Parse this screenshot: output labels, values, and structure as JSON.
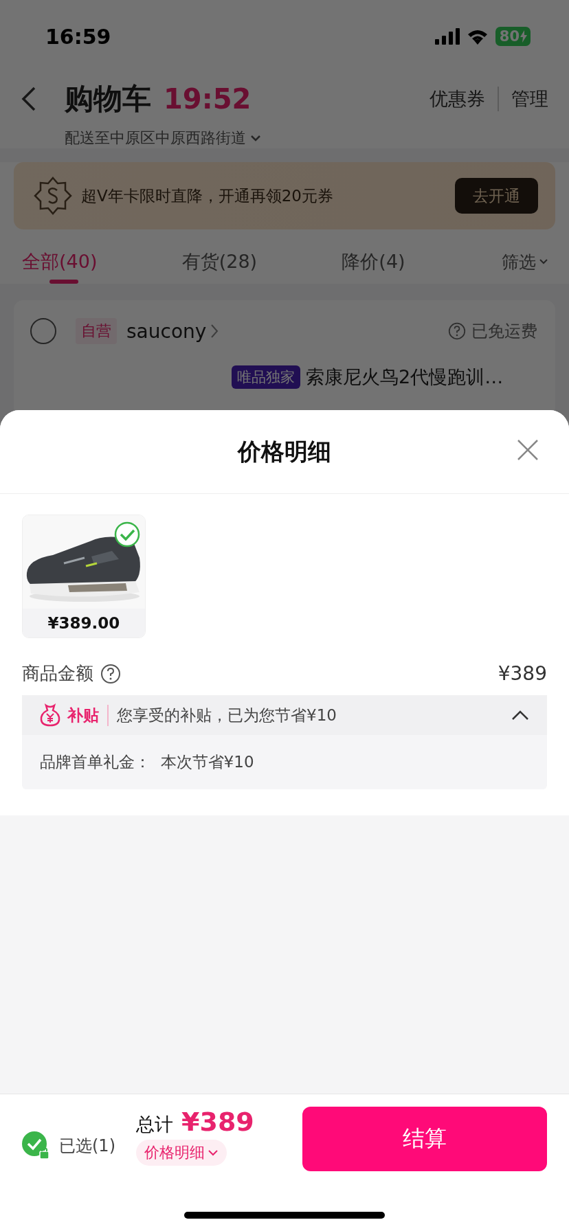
{
  "status_bar": {
    "time": "16:59",
    "battery": "80"
  },
  "header": {
    "title": "购物车",
    "countdown": "19:52",
    "actions": [
      "优惠券",
      "管理"
    ],
    "address": "配送至中原区中原西路街道"
  },
  "banner": {
    "text": "超V年卡限时直降，开通再领20元券",
    "button": "去开通"
  },
  "tabs": [
    {
      "label": "全部(40)",
      "selected": true
    },
    {
      "label": "有货(28)",
      "selected": false
    },
    {
      "label": "降价(4)",
      "selected": false
    }
  ],
  "filter": "筛选",
  "store": {
    "checked": false,
    "tag": "自营",
    "name": "saucony",
    "shipping": "已免运费",
    "product_badge": "唯品独家",
    "product_title": "索康尼火鸟2代慢跑训…"
  },
  "sheet": {
    "title": "价格明细",
    "items": [
      {
        "price": "¥389.00",
        "selected": true
      }
    ],
    "amount_label": "商品金额",
    "amount": "¥389",
    "subsidy": {
      "tag": "补贴",
      "summary": "您享受的补贴，已为您节省¥10",
      "expanded": true,
      "details": [
        "品牌首单礼金：  本次节省¥10"
      ]
    }
  },
  "footer": {
    "all_selected": true,
    "selected_label": "已选(1)",
    "total_label": "总计",
    "total": "¥389",
    "details_button": "价格明细",
    "checkout": "结算"
  }
}
